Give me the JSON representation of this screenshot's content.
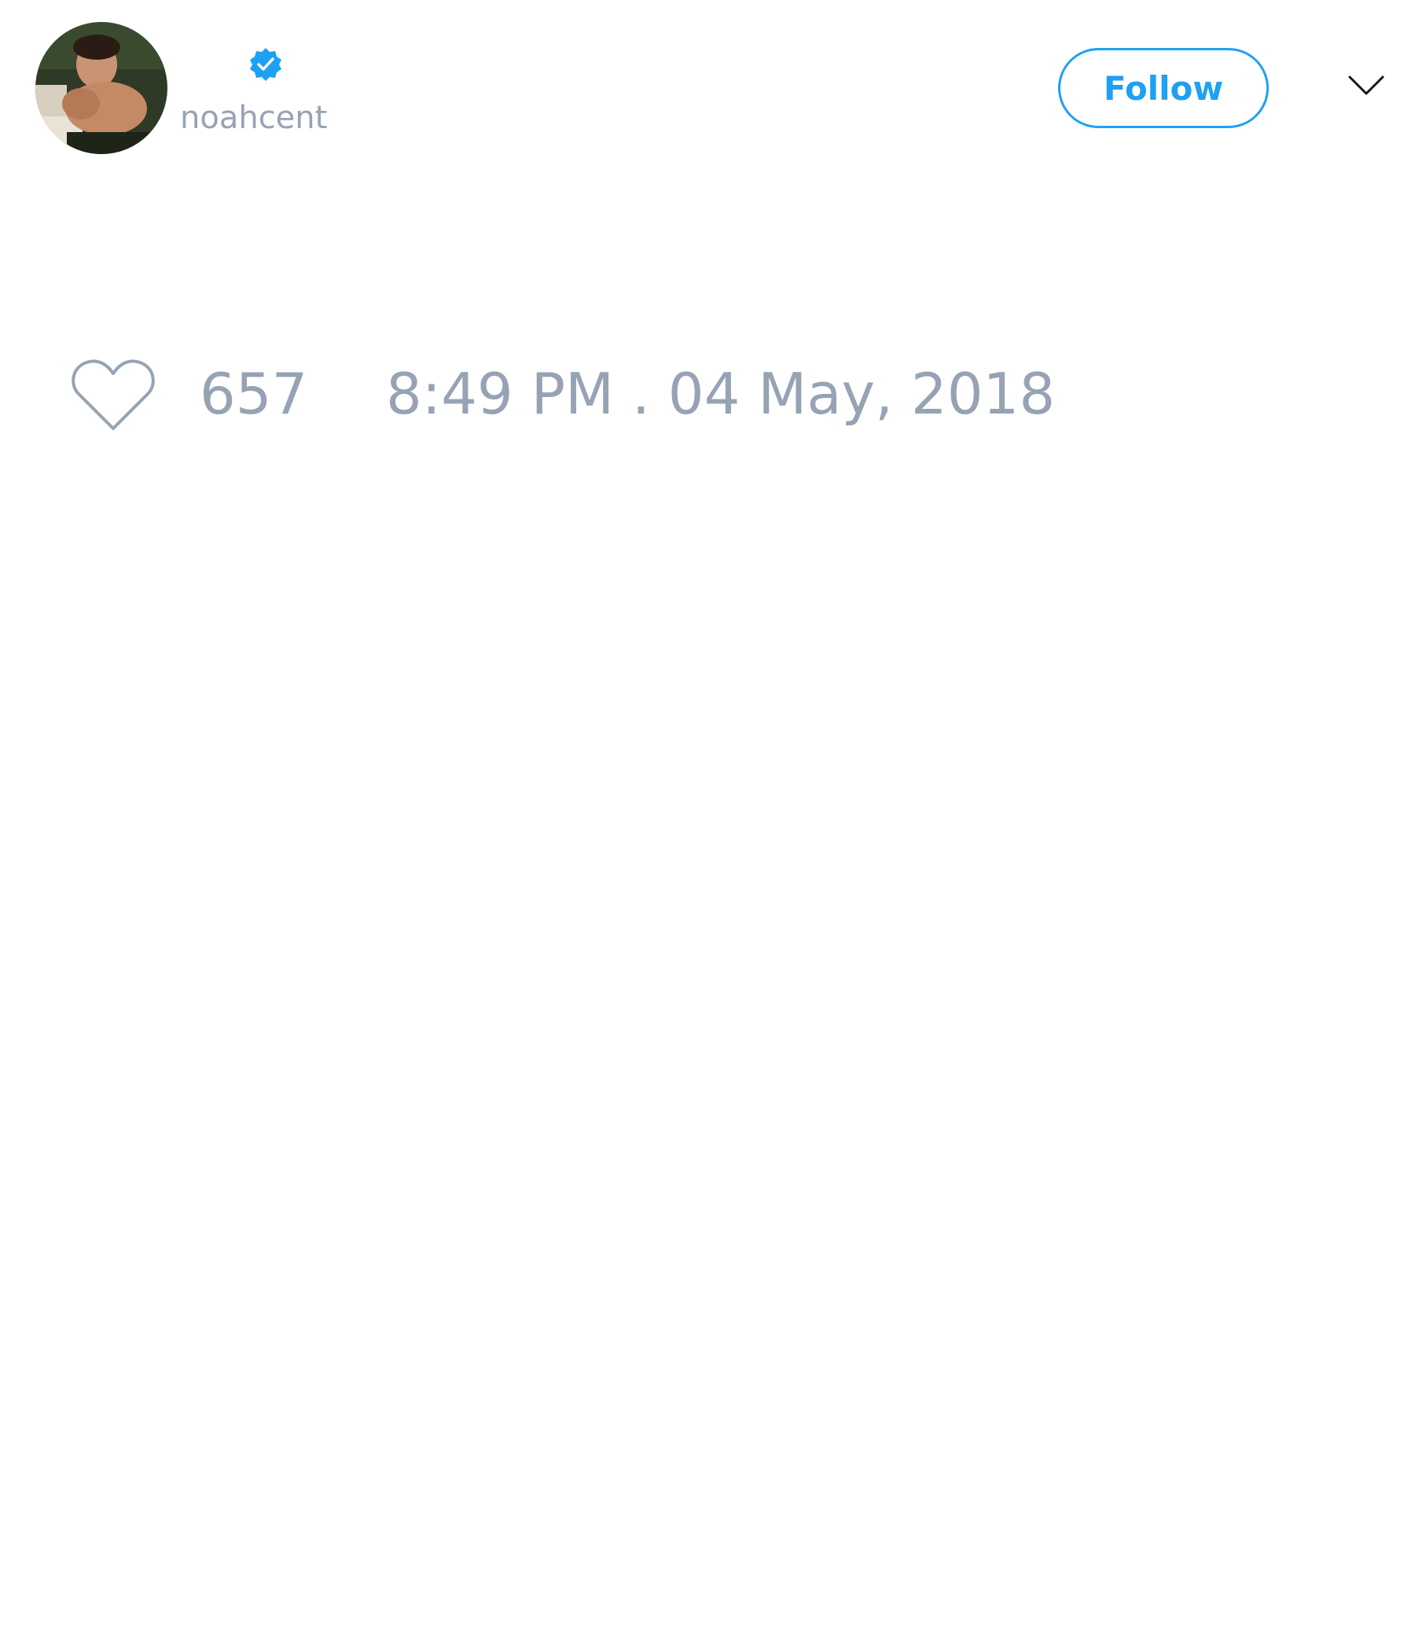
{
  "tweet": {
    "author": {
      "display_name": "",
      "username": "noahcent",
      "verified": true,
      "avatar_icon": "profile-photo"
    },
    "header": {
      "follow_label": "Follow",
      "menu_icon": "chevron-down-icon"
    },
    "footer": {
      "like_icon": "heart-outline-icon",
      "like_count": "657",
      "timestamp": "8:49 PM . 04 May, 2018"
    }
  },
  "colors": {
    "accent": "#1da1f2",
    "muted_text": "#96a3b4",
    "background": "#ffffff"
  }
}
